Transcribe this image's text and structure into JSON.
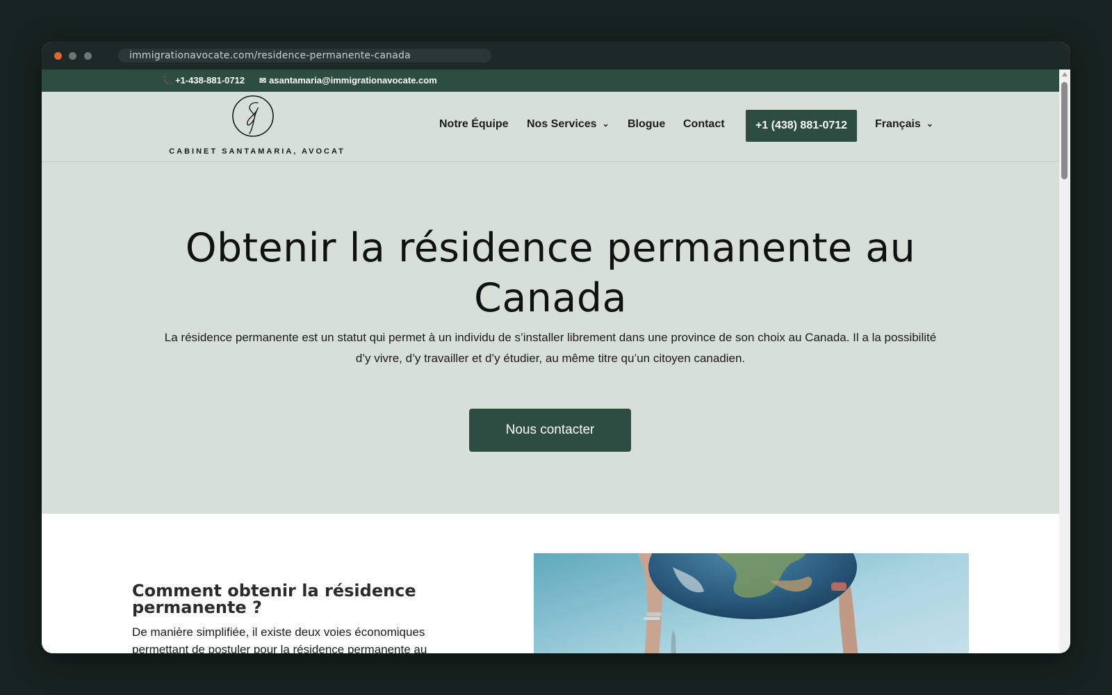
{
  "browser": {
    "url": "immigrationavocate.com/residence-permanente-canada"
  },
  "topbar": {
    "phone": "+1-438-881-0712",
    "email": "asantamaria@immigrationavocate.com"
  },
  "header": {
    "logo_text": "CABINET SANTAMARIA, AVOCAT",
    "nav": {
      "team": "Notre Équipe",
      "services": "Nos Services",
      "blog": "Blogue",
      "contact": "Contact",
      "cta": "+1 (438) 881-0712",
      "language": "Français"
    }
  },
  "hero": {
    "title": "Obtenir la résidence permanente au Canada",
    "description": "La résidence permanente est un statut qui permet à un individu de s’installer librement dans une province de son choix au Canada. Il a la possibilité d’y vivre, d’y travailler et d’y étudier, au même titre qu’un citoyen canadien.",
    "button": "Nous contacter"
  },
  "section": {
    "title": "Comment obtenir la résidence permanente ?",
    "text": "De manière simplifiée, il existe deux voies économiques permettant de postuler pour la résidence permanente au"
  },
  "colors": {
    "brand_green": "#2d4d43",
    "hero_bg": "#d6e0d8",
    "window_bg": "#172320"
  },
  "icons": {
    "phone": "phone-icon",
    "email": "envelope-icon",
    "dropdown": "chevron-down-icon"
  }
}
